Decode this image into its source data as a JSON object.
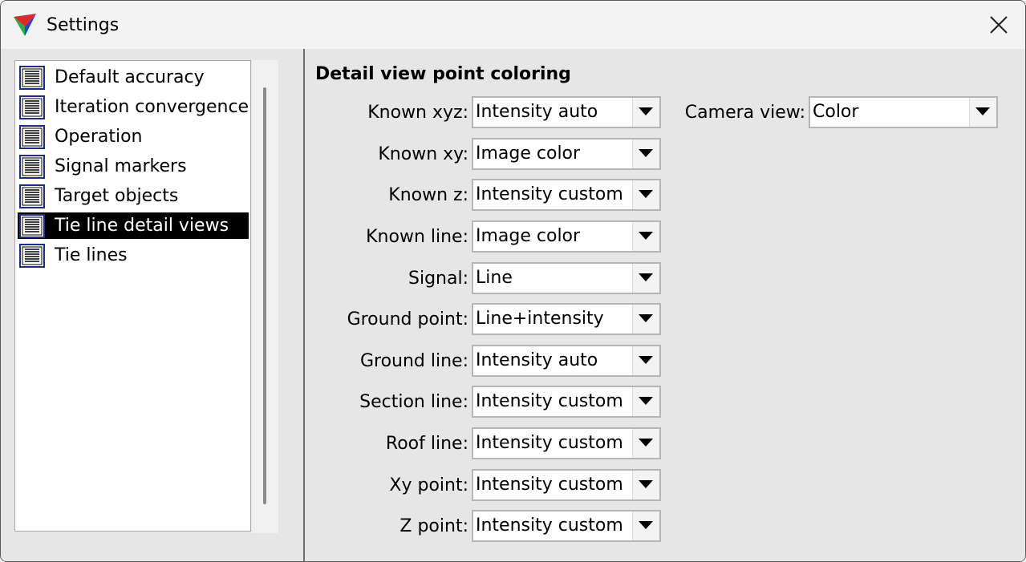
{
  "window": {
    "title": "Settings"
  },
  "tree": {
    "items": [
      {
        "label": "Default accuracy",
        "selected": false
      },
      {
        "label": "Iteration convergence",
        "selected": false
      },
      {
        "label": "Operation",
        "selected": false
      },
      {
        "label": "Signal markers",
        "selected": false
      },
      {
        "label": "Target objects",
        "selected": false
      },
      {
        "label": "Tie line detail views",
        "selected": true
      },
      {
        "label": "Tie lines",
        "selected": false
      }
    ]
  },
  "panel": {
    "title": "Detail view point coloring",
    "rows": [
      {
        "label": "Known xyz:",
        "value": "Intensity auto"
      },
      {
        "label": "Known xy:",
        "value": "Image color"
      },
      {
        "label": "Known z:",
        "value": "Intensity custom"
      },
      {
        "label": "Known line:",
        "value": "Image color"
      },
      {
        "label": "Signal:",
        "value": "Line"
      },
      {
        "label": "Ground point:",
        "value": "Line+intensity"
      },
      {
        "label": "Ground line:",
        "value": "Intensity auto"
      },
      {
        "label": "Section line:",
        "value": "Intensity custom"
      },
      {
        "label": "Roof line:",
        "value": "Intensity custom"
      },
      {
        "label": "Xy point:",
        "value": "Intensity custom"
      },
      {
        "label": "Z point:",
        "value": "Intensity custom"
      }
    ],
    "camera_view": {
      "label": "Camera view:",
      "value": "Color"
    }
  },
  "icons": {
    "app": "app-logo-icon",
    "close": "close-icon",
    "tree_item": "document-icon",
    "dropdown": "chevron-down-icon"
  },
  "colors": {
    "selection": "#000000",
    "background": "#e6e6e6"
  }
}
